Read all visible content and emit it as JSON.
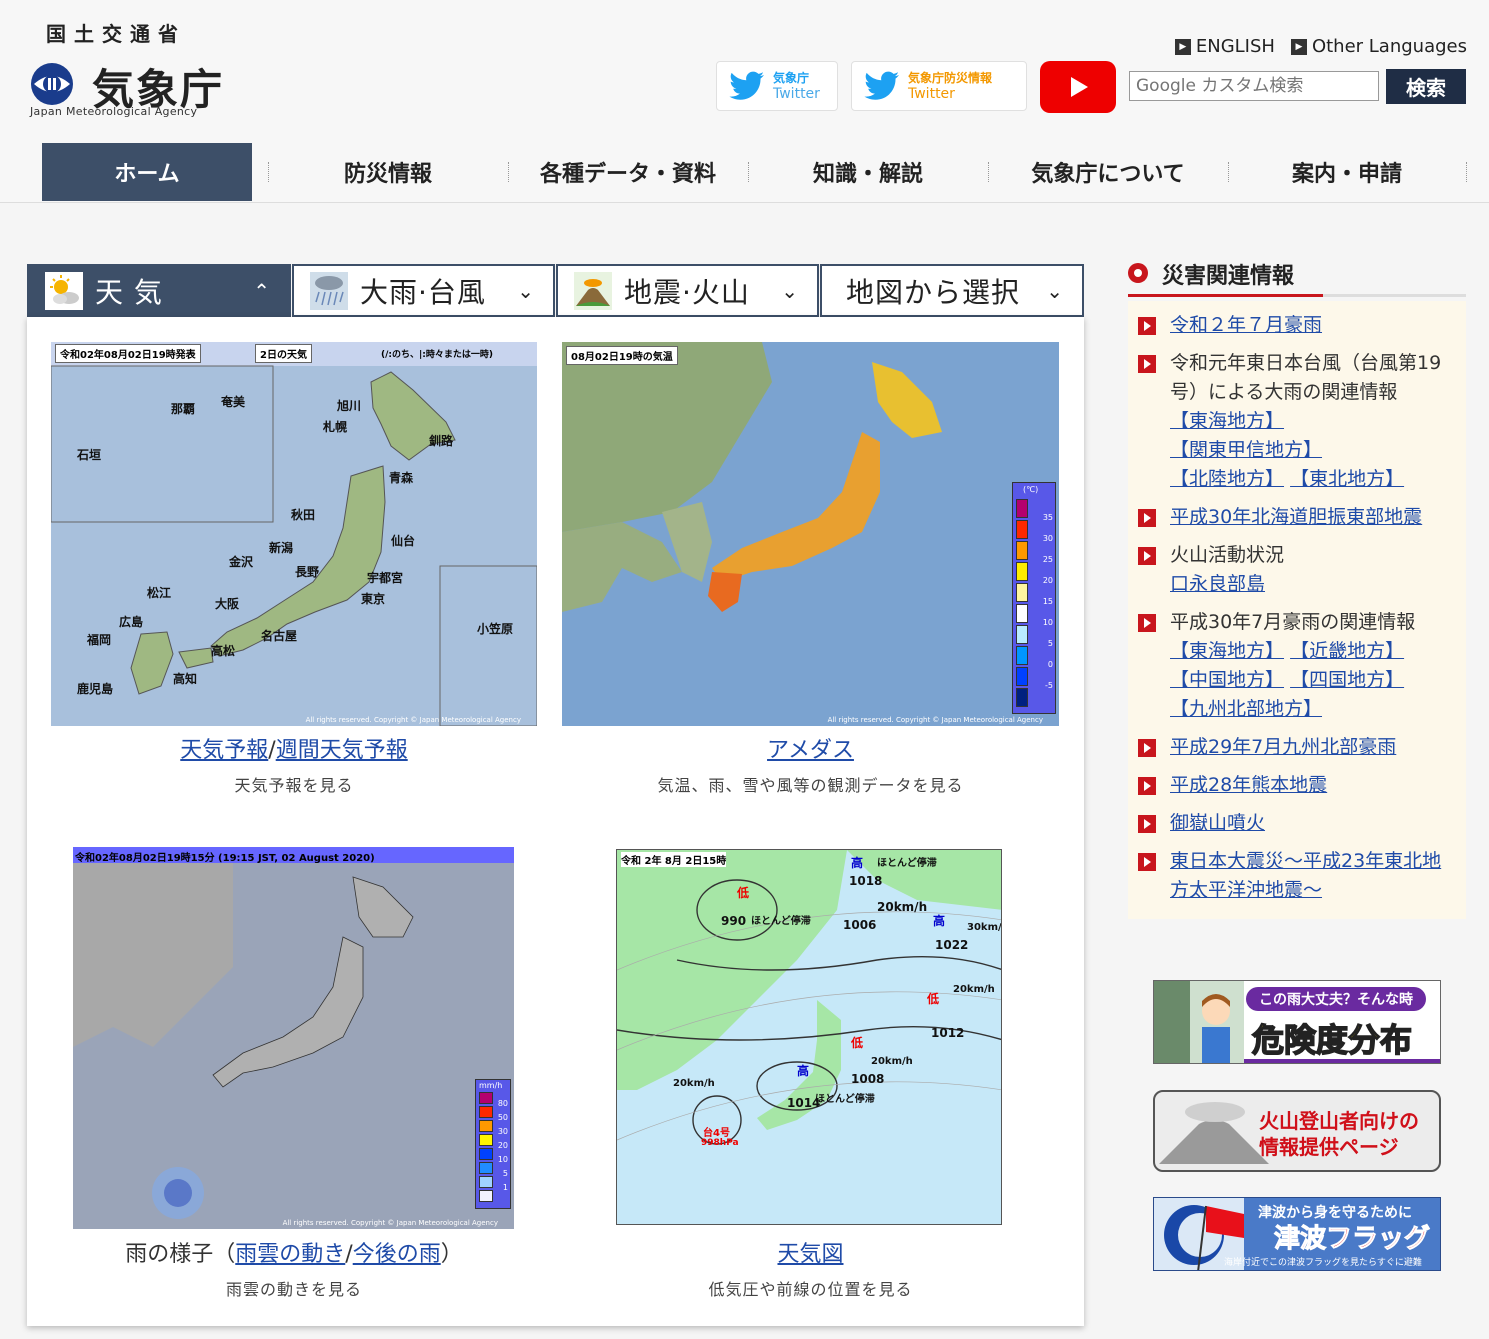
{
  "header": {
    "ministry": "国土交通省",
    "agency_name": "気象庁",
    "agency_en": "Japan Meteorological Agency",
    "lang_english": "ENGLISH",
    "lang_other": "Other Languages",
    "twitter1_line1": "気象庁",
    "twitter1_line2": "Twitter",
    "twitter2_line1": "気象庁防災情報",
    "twitter2_line2": "Twitter",
    "search_placeholder": "Google カスタム検索",
    "search_button": "検索"
  },
  "nav": {
    "items": [
      "ホーム",
      "防災情報",
      "各種データ・資料",
      "知識・解説",
      "気象庁について",
      "案内・申請"
    ]
  },
  "tabs": [
    "天 気",
    "大雨·台風",
    "地震·火山",
    "地図から選択"
  ],
  "maps": [
    {
      "caption_link1": "天気予報",
      "caption_sep": "/",
      "caption_link2": "週間天気予報",
      "desc": "天気予報を見る",
      "stamp1": "令和02年08月02日19時発表",
      "stamp2": "2日の天気",
      "stamp3": "(/:のち、|:時々または一時)",
      "cities": [
        "那覇",
        "奄美",
        "石垣",
        "旭川",
        "札幌",
        "釧路",
        "青森",
        "秋田",
        "仙台",
        "新潟",
        "金沢",
        "長野",
        "宇都宮",
        "東京",
        "松江",
        "大阪",
        "広島",
        "福岡",
        "高松",
        "名古屋",
        "高知",
        "鹿児島",
        "小笠原"
      ],
      "copyright": "All rights reserved. Copyright © Japan Meteorological Agency"
    },
    {
      "caption_link1": "アメダス",
      "desc": "気温、雨、雪や風等の観測データを見る",
      "stamp1": "08月02日19時の気温",
      "legend_unit": "(℃)",
      "legend_values": [
        "35",
        "30",
        "25",
        "20",
        "15",
        "10",
        "5",
        "0",
        "-5"
      ],
      "legend_colors": [
        "#b4006e",
        "#ff2800",
        "#ff9900",
        "#ffec00",
        "#fff5a0",
        "#ffffff",
        "#b9ebff",
        "#0096ff",
        "#0041ff",
        "#002080"
      ],
      "copyright": "All rights reserved. Copyright © Japan Meteorological Agency"
    },
    {
      "caption_prefix": "雨の様子（",
      "caption_link1": "雨雲の動き",
      "caption_sep": "/",
      "caption_link2": "今後の雨",
      "caption_suffix": "）",
      "desc": "雨雲の動きを見る",
      "stamp1": "令和02年08月02日19時15分 (19:15 JST, 02 August 2020)",
      "legend_unit": "mm/h",
      "legend_values": [
        "80",
        "50",
        "30",
        "20",
        "10",
        "5",
        "1"
      ],
      "legend_colors": [
        "#b4006e",
        "#ff2800",
        "#ff9900",
        "#fff500",
        "#0041ff",
        "#218cff",
        "#a0d2ff",
        "#f2f2ff"
      ],
      "copyright": "All rights reserved. Copyright © Japan Meteorological Agency"
    },
    {
      "caption_link1": "天気図",
      "desc": "低気圧や前線の位置を見る",
      "stamp1": "令和 2年 8月 2日15時",
      "labels": [
        "低",
        "990",
        "ほとんど停滞",
        "高",
        "1018",
        "ほとんど停滞",
        "1006",
        "20km/h",
        "高",
        "1022",
        "30km/h",
        "低",
        "20km/h",
        "1012",
        "低",
        "20km/h",
        "1008",
        "高",
        "1014",
        "ほとんど停滞",
        "20km/h",
        "台4号",
        "998hPa"
      ]
    }
  ],
  "sidebar": {
    "title": "災害関連情報",
    "items": [
      {
        "link": "令和２年７月豪雨"
      },
      {
        "text": "令和元年東日本台風（台風第19号）による大雨の関連情報",
        "links": [
          "【東海地方】",
          "【関東甲信地方】",
          "【北陸地方】",
          "【東北地方】"
        ]
      },
      {
        "link": "平成30年北海道胆振東部地震"
      },
      {
        "text": "火山活動状況",
        "links": [
          "口永良部島"
        ]
      },
      {
        "text": "平成30年7月豪雨の関連情報",
        "links": [
          "【東海地方】",
          "【近畿地方】",
          "【中国地方】",
          "【四国地方】",
          "【九州北部地方】"
        ]
      },
      {
        "link": "平成29年7月九州北部豪雨"
      },
      {
        "link": "平成28年熊本地震"
      },
      {
        "link": "御嶽山噴火"
      },
      {
        "link": "東日本大震災～平成23年東北地方太平洋沖地震～"
      }
    ]
  },
  "banners": {
    "kikendo_line1": "この雨大丈夫？そんな時",
    "kikendo_line2": "危険度分布",
    "volcano_line1": "火山登山者向けの",
    "volcano_line2": "情報提供ページ",
    "tsunami_line1": "津波から身を守るために",
    "tsunami_line2": "津波フラッグ",
    "tsunami_line3": "海岸付近でこの津波フラッグを見たらすぐに避難"
  },
  "colors": {
    "nav_active": "#3d4f68",
    "accent_red": "#c8161d",
    "link": "#1f4ba8"
  }
}
